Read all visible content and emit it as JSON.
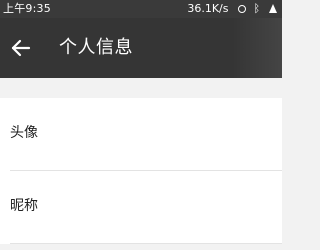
{
  "status_bar": {
    "time": "上午9:35",
    "network_speed": "36.1K/s",
    "icons": [
      "alarm-icon",
      "bluetooth-icon",
      "signal-icon"
    ]
  },
  "app_bar": {
    "title": "个人信息",
    "back_icon": "arrow-left-icon"
  },
  "list": {
    "items": [
      {
        "label": "头像"
      },
      {
        "label": "昵称"
      }
    ]
  },
  "colors": {
    "app_bar": "#353535",
    "status_bar": "#3a3a3a",
    "background": "#f2f2f2",
    "list_item_background": "#ffffff",
    "divider": "#e3e3e3",
    "text_primary": "#222222",
    "text_on_dark": "#ffffff"
  }
}
